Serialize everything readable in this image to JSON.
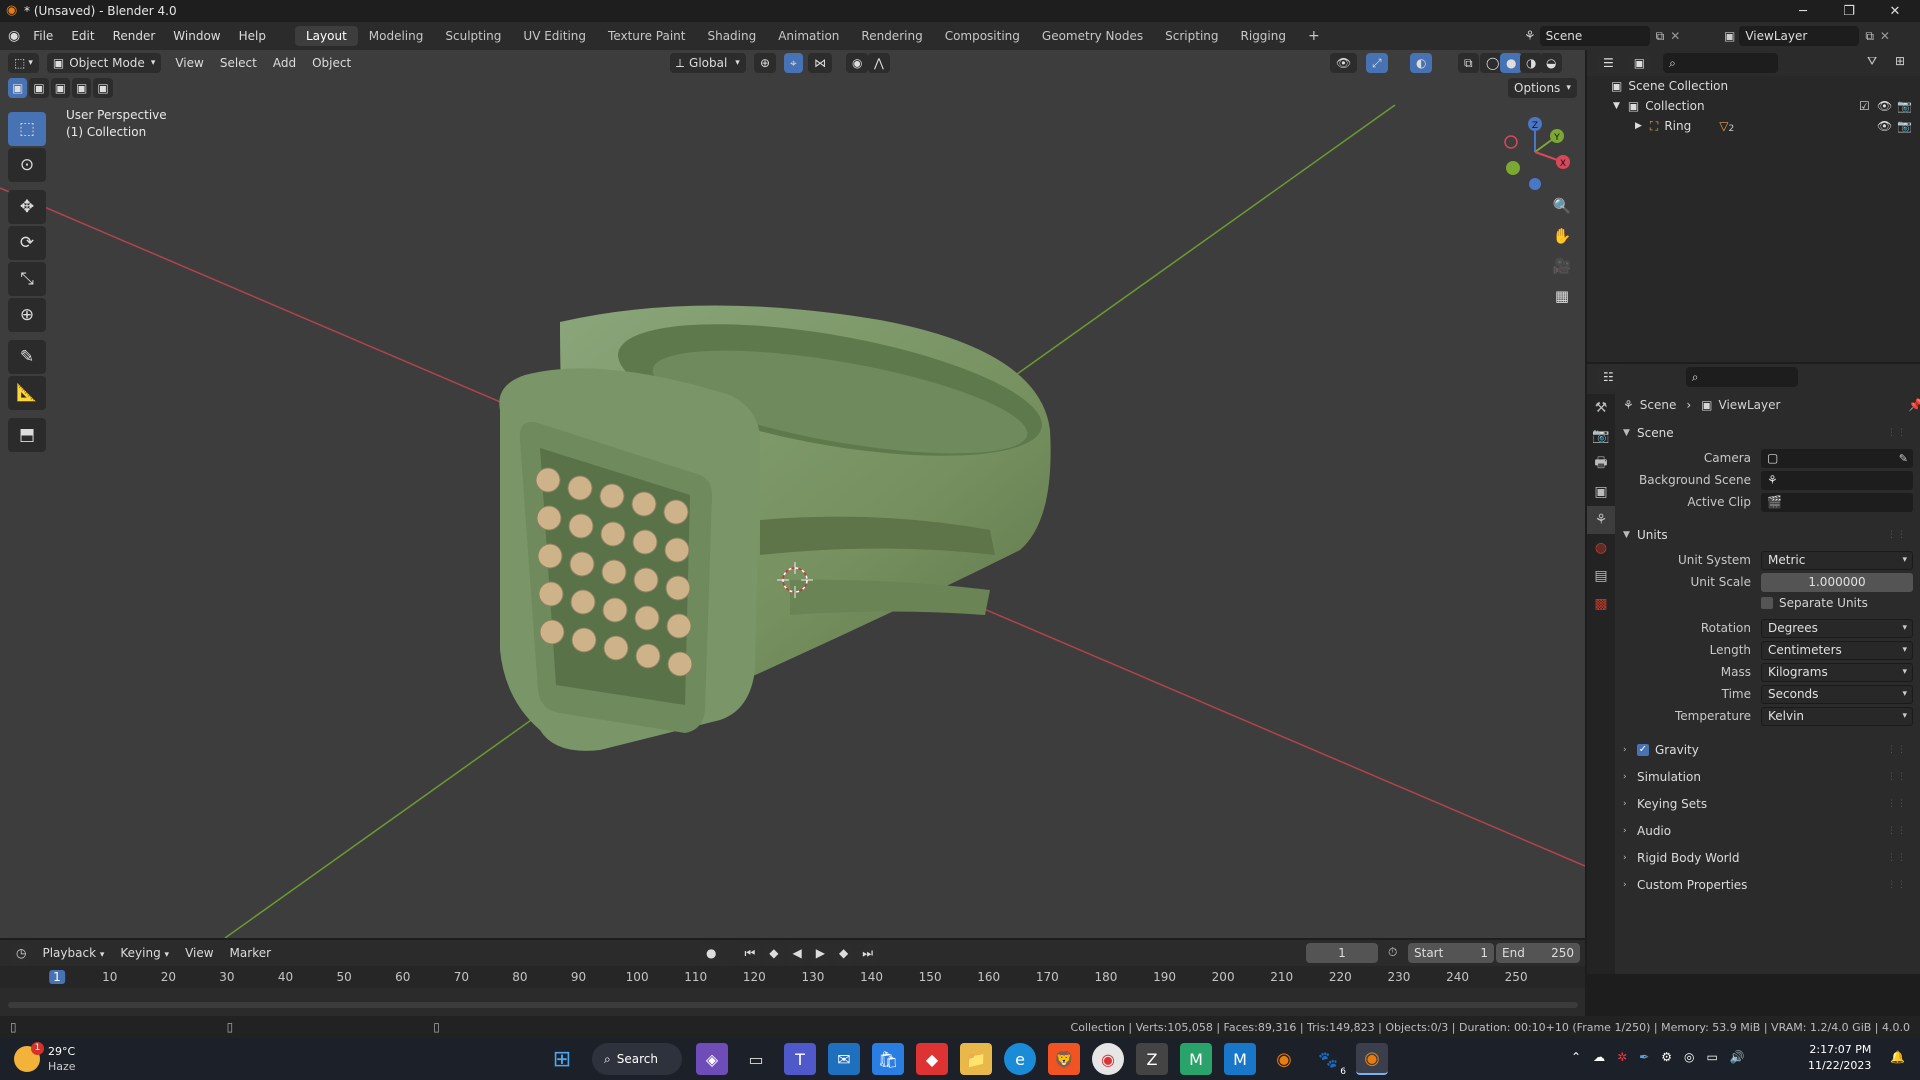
{
  "window": {
    "title": "* (Unsaved) - Blender 4.0",
    "minimize": "─",
    "maximize": "❐",
    "close": "✕"
  },
  "menubar": {
    "items": [
      "File",
      "Edit",
      "Render",
      "Window",
      "Help"
    ],
    "workspaces": [
      "Layout",
      "Modeling",
      "Sculpting",
      "UV Editing",
      "Texture Paint",
      "Shading",
      "Animation",
      "Rendering",
      "Compositing",
      "Geometry Nodes",
      "Scripting",
      "Rigging"
    ],
    "add_workspace": "+",
    "scene": "Scene",
    "view_layer": "ViewLayer"
  },
  "viewport": {
    "mode": "Object Mode",
    "menus": [
      "View",
      "Select",
      "Add",
      "Object"
    ],
    "orientation": "Global",
    "options": "Options",
    "perspective_label": "User Perspective",
    "collection_label": "(1) Collection",
    "gizmo_axes": {
      "z": "Z",
      "y": "Y",
      "x": "X"
    },
    "colors": {
      "background": "#3d3d3d",
      "x_axis": "#b0434f",
      "y_axis": "#6d9a2f",
      "ring": "#7f9a6e",
      "stone": "#cdb28a",
      "active": "#4772b3"
    }
  },
  "outliner": {
    "scene_collection": "Scene Collection",
    "collection": "Collection",
    "object": "Ring",
    "modifier_count": "2"
  },
  "properties": {
    "breadcrumb_scene": "Scene",
    "breadcrumb_view_layer": "ViewLayer",
    "scene_panel": "Scene",
    "camera_label": "Camera",
    "background_scene_label": "Background Scene",
    "active_clip_label": "Active Clip",
    "units_panel": "Units",
    "unit_system_label": "Unit System",
    "unit_system": "Metric",
    "unit_scale_label": "Unit Scale",
    "unit_scale": "1.000000",
    "separate_units": "Separate Units",
    "rotation_label": "Rotation",
    "rotation": "Degrees",
    "length_label": "Length",
    "length": "Centimeters",
    "mass_label": "Mass",
    "mass": "Kilograms",
    "time_label": "Time",
    "time": "Seconds",
    "temperature_label": "Temperature",
    "temperature": "Kelvin",
    "gravity": "Gravity",
    "collapsed_panels": [
      "Simulation",
      "Keying Sets",
      "Audio",
      "Rigid Body World",
      "Custom Properties"
    ]
  },
  "timeline": {
    "menus": [
      "Playback",
      "Keying",
      "View",
      "Marker"
    ],
    "current_frame": "1",
    "start_label": "Start",
    "start": "1",
    "end_label": "End",
    "end": "250",
    "ruler_marks": [
      "1",
      "10",
      "20",
      "30",
      "40",
      "50",
      "60",
      "70",
      "80",
      "90",
      "100",
      "110",
      "120",
      "130",
      "140",
      "150",
      "160",
      "170",
      "180",
      "190",
      "200",
      "210",
      "220",
      "230",
      "240",
      "250"
    ]
  },
  "statusbar": {
    "stats": "Collection | Verts:105,058 | Faces:89,316 | Tris:149,823 | Objects:0/3 | Duration: 00:10+10 (Frame 1/250) | Memory: 53.9 MiB | VRAM: 1.2/4.0 GiB | 4.0.0"
  },
  "taskbar": {
    "weather_temp": "29°C",
    "weather_desc": "Haze",
    "weather_badge": "1",
    "search": "Search",
    "time": "2:17:07 PM",
    "date": "11/22/2023",
    "blender_badge": "6"
  }
}
